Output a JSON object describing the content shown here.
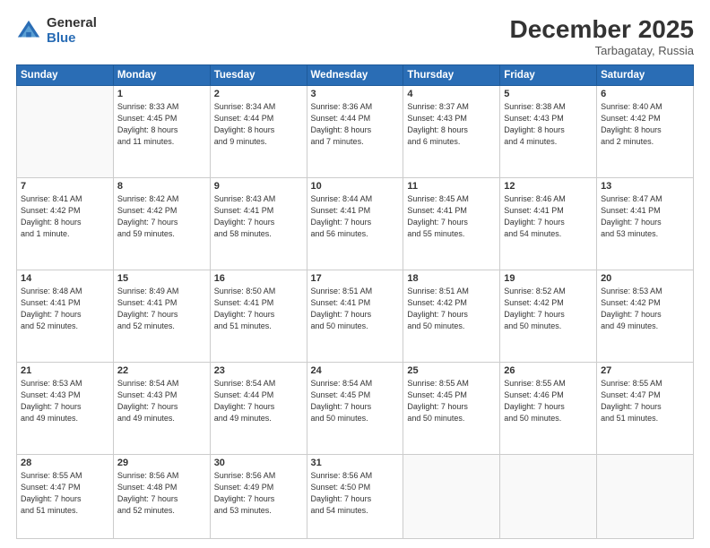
{
  "logo": {
    "general": "General",
    "blue": "Blue"
  },
  "header": {
    "month": "December 2025",
    "location": "Tarbagatay, Russia"
  },
  "weekdays": [
    "Sunday",
    "Monday",
    "Tuesday",
    "Wednesday",
    "Thursday",
    "Friday",
    "Saturday"
  ],
  "weeks": [
    [
      {
        "day": "",
        "info": ""
      },
      {
        "day": "1",
        "info": "Sunrise: 8:33 AM\nSunset: 4:45 PM\nDaylight: 8 hours\nand 11 minutes."
      },
      {
        "day": "2",
        "info": "Sunrise: 8:34 AM\nSunset: 4:44 PM\nDaylight: 8 hours\nand 9 minutes."
      },
      {
        "day": "3",
        "info": "Sunrise: 8:36 AM\nSunset: 4:44 PM\nDaylight: 8 hours\nand 7 minutes."
      },
      {
        "day": "4",
        "info": "Sunrise: 8:37 AM\nSunset: 4:43 PM\nDaylight: 8 hours\nand 6 minutes."
      },
      {
        "day": "5",
        "info": "Sunrise: 8:38 AM\nSunset: 4:43 PM\nDaylight: 8 hours\nand 4 minutes."
      },
      {
        "day": "6",
        "info": "Sunrise: 8:40 AM\nSunset: 4:42 PM\nDaylight: 8 hours\nand 2 minutes."
      }
    ],
    [
      {
        "day": "7",
        "info": "Sunrise: 8:41 AM\nSunset: 4:42 PM\nDaylight: 8 hours\nand 1 minute."
      },
      {
        "day": "8",
        "info": "Sunrise: 8:42 AM\nSunset: 4:42 PM\nDaylight: 7 hours\nand 59 minutes."
      },
      {
        "day": "9",
        "info": "Sunrise: 8:43 AM\nSunset: 4:41 PM\nDaylight: 7 hours\nand 58 minutes."
      },
      {
        "day": "10",
        "info": "Sunrise: 8:44 AM\nSunset: 4:41 PM\nDaylight: 7 hours\nand 56 minutes."
      },
      {
        "day": "11",
        "info": "Sunrise: 8:45 AM\nSunset: 4:41 PM\nDaylight: 7 hours\nand 55 minutes."
      },
      {
        "day": "12",
        "info": "Sunrise: 8:46 AM\nSunset: 4:41 PM\nDaylight: 7 hours\nand 54 minutes."
      },
      {
        "day": "13",
        "info": "Sunrise: 8:47 AM\nSunset: 4:41 PM\nDaylight: 7 hours\nand 53 minutes."
      }
    ],
    [
      {
        "day": "14",
        "info": "Sunrise: 8:48 AM\nSunset: 4:41 PM\nDaylight: 7 hours\nand 52 minutes."
      },
      {
        "day": "15",
        "info": "Sunrise: 8:49 AM\nSunset: 4:41 PM\nDaylight: 7 hours\nand 52 minutes."
      },
      {
        "day": "16",
        "info": "Sunrise: 8:50 AM\nSunset: 4:41 PM\nDaylight: 7 hours\nand 51 minutes."
      },
      {
        "day": "17",
        "info": "Sunrise: 8:51 AM\nSunset: 4:41 PM\nDaylight: 7 hours\nand 50 minutes."
      },
      {
        "day": "18",
        "info": "Sunrise: 8:51 AM\nSunset: 4:42 PM\nDaylight: 7 hours\nand 50 minutes."
      },
      {
        "day": "19",
        "info": "Sunrise: 8:52 AM\nSunset: 4:42 PM\nDaylight: 7 hours\nand 50 minutes."
      },
      {
        "day": "20",
        "info": "Sunrise: 8:53 AM\nSunset: 4:42 PM\nDaylight: 7 hours\nand 49 minutes."
      }
    ],
    [
      {
        "day": "21",
        "info": "Sunrise: 8:53 AM\nSunset: 4:43 PM\nDaylight: 7 hours\nand 49 minutes."
      },
      {
        "day": "22",
        "info": "Sunrise: 8:54 AM\nSunset: 4:43 PM\nDaylight: 7 hours\nand 49 minutes."
      },
      {
        "day": "23",
        "info": "Sunrise: 8:54 AM\nSunset: 4:44 PM\nDaylight: 7 hours\nand 49 minutes."
      },
      {
        "day": "24",
        "info": "Sunrise: 8:54 AM\nSunset: 4:45 PM\nDaylight: 7 hours\nand 50 minutes."
      },
      {
        "day": "25",
        "info": "Sunrise: 8:55 AM\nSunset: 4:45 PM\nDaylight: 7 hours\nand 50 minutes."
      },
      {
        "day": "26",
        "info": "Sunrise: 8:55 AM\nSunset: 4:46 PM\nDaylight: 7 hours\nand 50 minutes."
      },
      {
        "day": "27",
        "info": "Sunrise: 8:55 AM\nSunset: 4:47 PM\nDaylight: 7 hours\nand 51 minutes."
      }
    ],
    [
      {
        "day": "28",
        "info": "Sunrise: 8:55 AM\nSunset: 4:47 PM\nDaylight: 7 hours\nand 51 minutes."
      },
      {
        "day": "29",
        "info": "Sunrise: 8:56 AM\nSunset: 4:48 PM\nDaylight: 7 hours\nand 52 minutes."
      },
      {
        "day": "30",
        "info": "Sunrise: 8:56 AM\nSunset: 4:49 PM\nDaylight: 7 hours\nand 53 minutes."
      },
      {
        "day": "31",
        "info": "Sunrise: 8:56 AM\nSunset: 4:50 PM\nDaylight: 7 hours\nand 54 minutes."
      },
      {
        "day": "",
        "info": ""
      },
      {
        "day": "",
        "info": ""
      },
      {
        "day": "",
        "info": ""
      }
    ]
  ]
}
